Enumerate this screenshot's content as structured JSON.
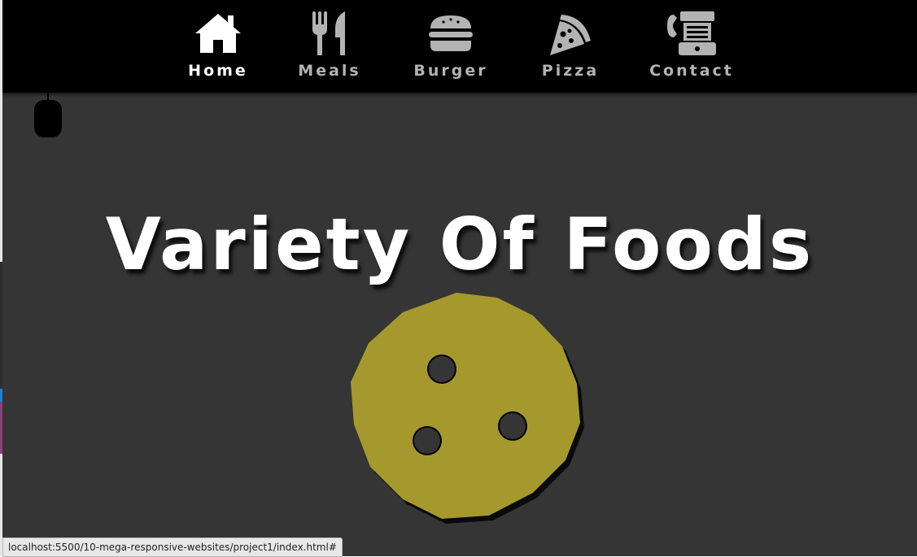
{
  "colors": {
    "background": "#353535",
    "navbar": "#000000",
    "nav_active": "#ffffff",
    "nav_inactive": "#b3b3b3",
    "cookie": "#a5992e",
    "title": "#ffffff"
  },
  "nav": {
    "items": [
      {
        "label": "Home",
        "icon": "house-icon",
        "active": true
      },
      {
        "label": "Meals",
        "icon": "fork-knife-icon",
        "active": false
      },
      {
        "label": "Burger",
        "icon": "burger-icon",
        "active": false
      },
      {
        "label": "Pizza",
        "icon": "pizza-slice-icon",
        "active": false
      },
      {
        "label": "Contact",
        "icon": "fax-phone-icon",
        "active": false
      }
    ]
  },
  "hero": {
    "title": "Variety Of Foods",
    "scroll_indicator_icon": "mouse-icon",
    "image_icon": "cookie-icon"
  },
  "status_bar": {
    "url": "localhost:5500/10-mega-responsive-websites/project1/index.html#"
  }
}
